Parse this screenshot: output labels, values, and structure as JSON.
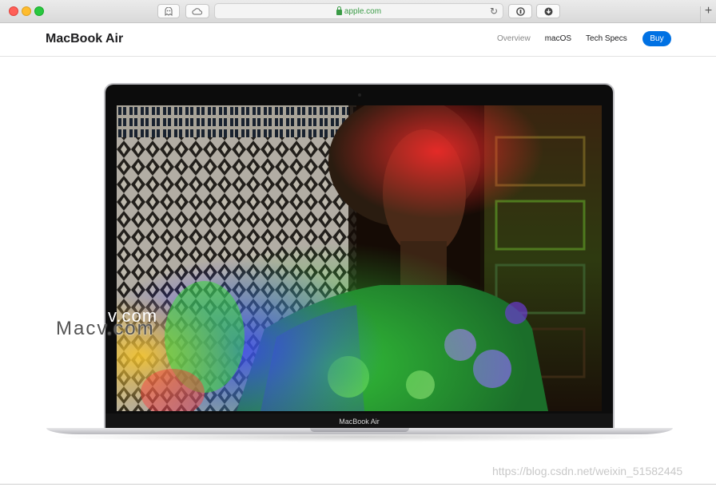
{
  "browser": {
    "url": "apple.com",
    "new_tab_symbol": "+"
  },
  "localnav": {
    "product_title": "MacBook Air",
    "links": [
      {
        "label": "Overview"
      },
      {
        "label": "macOS"
      },
      {
        "label": "Tech Specs"
      }
    ],
    "buy_label": "Buy"
  },
  "hero": {
    "chin_label": "MacBook Air"
  },
  "overlays": {
    "watermark_text": "Macv.com",
    "watermark_text_2": "v.com",
    "csdn_url": "https://blog.csdn.net/weixin_51582445"
  },
  "colors": {
    "accent": "#0071e3",
    "url_green": "#3a9b46"
  }
}
